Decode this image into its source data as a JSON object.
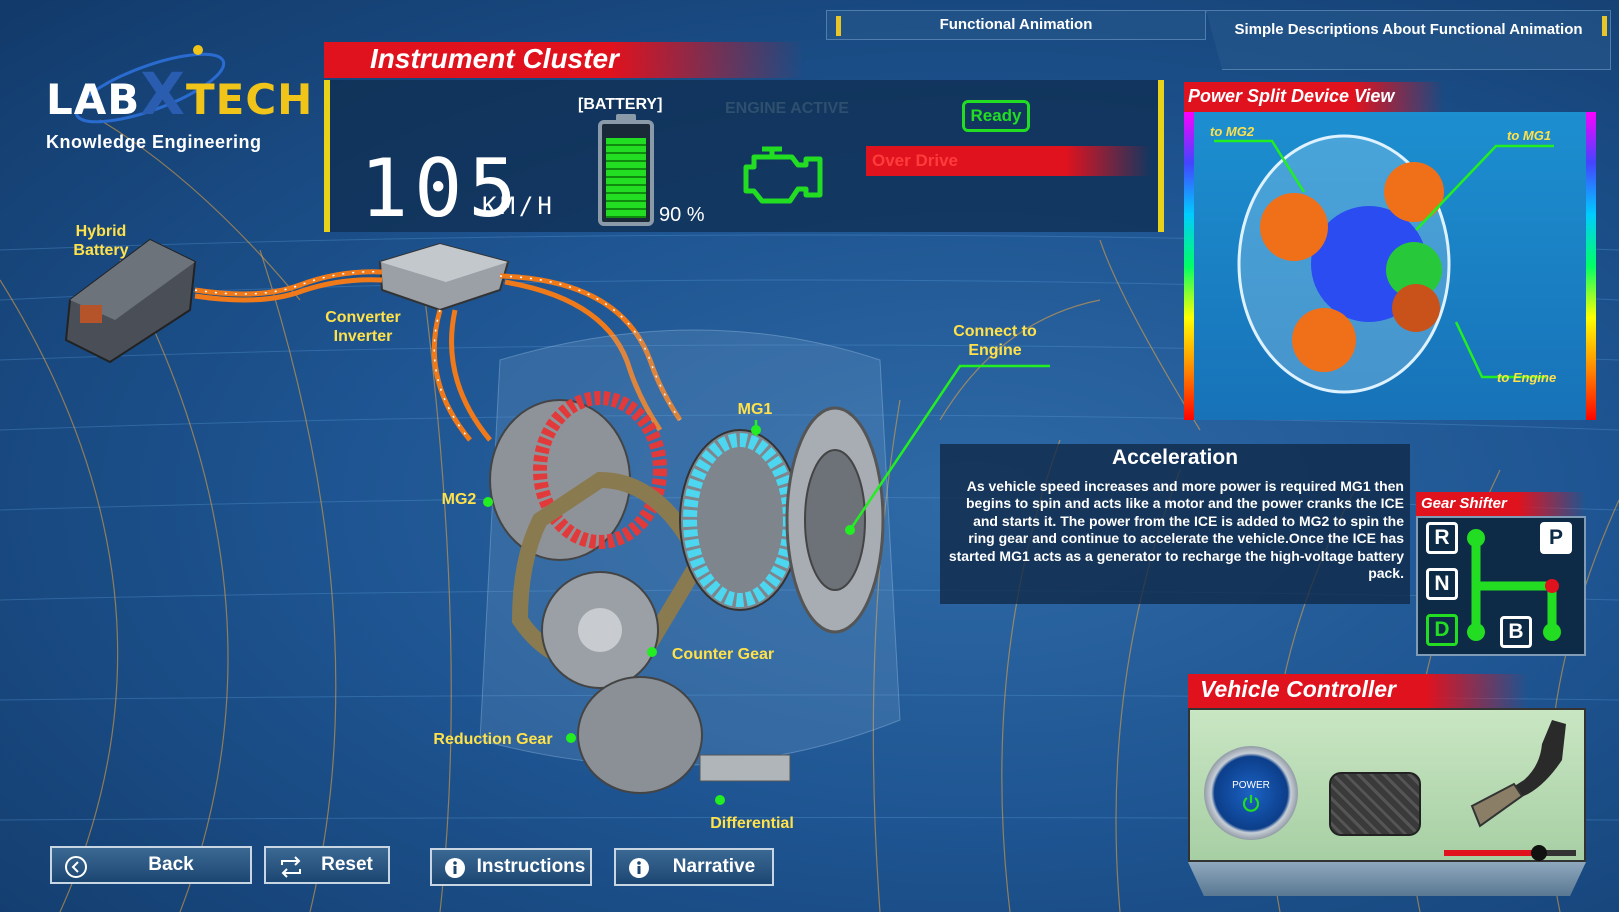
{
  "logo": {
    "lab": "LAB",
    "x": "X",
    "tech": "TECH",
    "subtitle": "Knowledge Engineering"
  },
  "tabs": {
    "functional_animation": "Functional Animation",
    "descriptions": "Simple Descriptions About Functional Animation"
  },
  "instrument_cluster": {
    "title": "Instrument Cluster",
    "speed": "105",
    "speed_unit": "KM/H",
    "battery_label": "[BATTERY]",
    "battery_percent": "90 %",
    "battery_level": 0.9,
    "engine_status": "ENGINE ACTIVE",
    "ready": "Ready",
    "overdrive": "Over Drive"
  },
  "scene_labels": {
    "hybrid_battery": "Hybrid Battery",
    "converter_inverter": "Converter Inverter",
    "connect_engine": "Connect to Engine",
    "mg1": "MG1",
    "mg2": "MG2",
    "counter_gear": "Counter Gear",
    "reduction_gear": "Reduction Gear",
    "differential": "Differential"
  },
  "power_split": {
    "title": "Power Split Device View",
    "to_mg2": "to MG2",
    "to_mg1": "to MG1",
    "to_engine": "to Engine"
  },
  "acceleration": {
    "title": "Acceleration",
    "text": "As vehicle speed increases and more power is required MG1 then begins to spin and acts like a motor and the power cranks the ICE and starts it. The power from the ICE is added to MG2 to spin the ring gear and continue to accelerate the vehicle.Once the ICE has started MG1 acts as a generator to recharge the high-voltage battery pack."
  },
  "gear_shifter": {
    "title": "Gear Shifter",
    "gears": {
      "r": "R",
      "n": "N",
      "d": "D",
      "b": "B",
      "p": "P"
    },
    "selected": "D"
  },
  "vehicle_controller": {
    "title": "Vehicle Controller",
    "power_label": "POWER",
    "throttle_level": 0.72
  },
  "buttons": {
    "back": "Back",
    "reset": "Reset",
    "instructions": "Instructions",
    "narrative": "Narrative"
  },
  "colors": {
    "accent_red": "#e0121e",
    "label_yellow": "#ffe14a",
    "active_green": "#22dd22",
    "frame_yellow": "#e8d31a"
  }
}
